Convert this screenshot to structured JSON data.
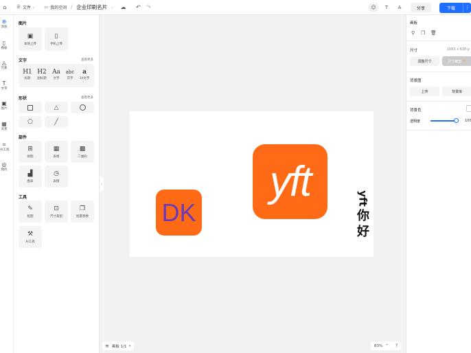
{
  "topbar": {
    "file_menu": "文件",
    "breadcrumb_folder": "我的空间",
    "breadcrumb_sep": "/",
    "doc_title": "企业印刷名片",
    "share": "分享",
    "download": "下载"
  },
  "rail": {
    "items": [
      {
        "label": "添加",
        "icon": "plus-circle-icon"
      },
      {
        "label": "模板",
        "icon": "template-icon"
      },
      {
        "label": "元素",
        "icon": "shapes-icon"
      },
      {
        "label": "文字",
        "icon": "text-icon"
      },
      {
        "label": "图片",
        "icon": "image-icon"
      },
      {
        "label": "背景",
        "icon": "background-icon"
      },
      {
        "label": "AI工具",
        "icon": "ai-tool-icon"
      },
      {
        "label": "我的",
        "icon": "user-icon"
      }
    ]
  },
  "panel": {
    "image_section": "图片",
    "local_upload": "本地上传",
    "mobile_upload": "手机上传",
    "text_section": "文字",
    "text_more": "查看更多",
    "text_options": [
      {
        "glyph": "H1",
        "label": "标题"
      },
      {
        "glyph": "H2",
        "label": "副标题"
      },
      {
        "glyph": "Aa",
        "label": "文字"
      },
      {
        "glyph": "abc",
        "label": "花字"
      },
      {
        "glyph": "a",
        "label": "3d文字"
      }
    ],
    "shape_section": "形状",
    "shape_more": "查看更多",
    "widget_section": "部件",
    "widgets": [
      "拼图",
      "表格",
      "二维码",
      "图表",
      "表情"
    ],
    "tools_section": "工具",
    "tools": [
      "抠图",
      "尺寸裁剪",
      "批量替换",
      "AI工具"
    ]
  },
  "canvas": {
    "logo_dk_text": "DK",
    "logo_yft_text": "yft",
    "vertical_rot": "yft",
    "vertical_chars": [
      "你",
      "好"
    ]
  },
  "bottom": {
    "pages": "画板 1/1",
    "zoom": "83%",
    "help": "?"
  },
  "rpanel": {
    "section_canvas": "画板",
    "size_label": "尺寸",
    "size_value": "1063 x 638 p",
    "adjust_size": "调整尺寸",
    "crop_size": "尺寸裁剪",
    "bg_image_label": "背景图",
    "upload": "上传",
    "bg_library": "背景库",
    "bg_color_label": "背景色",
    "opacity_label": "透明度",
    "opacity_value": "100",
    "opacity_fraction": 1.0
  },
  "colors": {
    "accent": "#1e6fff",
    "logo_orange": "#ff6a16",
    "logo_dk_text": "#6b3ab8"
  }
}
